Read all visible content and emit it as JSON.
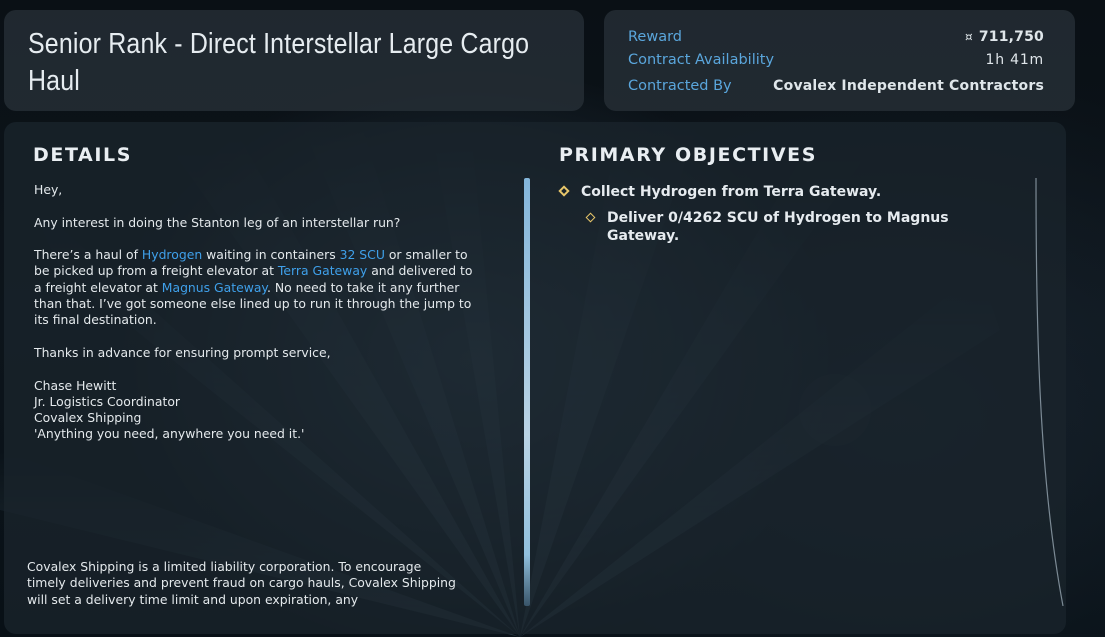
{
  "contract": {
    "title": "Senior Rank - Direct Interstellar Large Cargo Haul"
  },
  "info": {
    "reward_label": "Reward",
    "reward_currency_icon": "auec-currency-icon",
    "reward_value": "711,750",
    "availability_label": "Contract Availability",
    "availability_value": "1h 41m",
    "contracted_by_label": "Contracted By",
    "contracted_by_value": "Covalex Independent Contractors"
  },
  "details": {
    "heading": "DETAILS",
    "greeting": "Hey,",
    "question": "Any interest in doing the Stanton leg of an interstellar run?",
    "p3_a": "There’s a haul of ",
    "p3_commodity": "Hydrogen",
    "p3_b": " waiting in containers ",
    "p3_container": "32 SCU",
    "p3_c": " or smaller to be picked up from a freight elevator at ",
    "p3_pickup": "Terra Gateway",
    "p3_d": " and delivered to a freight elevator at ",
    "p3_dropoff": "Magnus Gateway",
    "p3_e": ". No need to take it any further than that. I’ve got someone else lined up to run it through the jump to its final destination.",
    "thanks": "Thanks in advance for ensuring prompt service,",
    "signature": {
      "name": "Chase Hewitt",
      "role": "Jr. Logistics Coordinator",
      "company": "Covalex Shipping",
      "motto": "'Anything you need, anywhere you need it.'"
    },
    "disclaimer": "Covalex Shipping is a limited liability corporation. To encourage timely deliveries and prevent fraud on cargo hauls, Covalex Shipping will set a delivery time limit and upon expiration, any"
  },
  "objectives": {
    "heading": "PRIMARY OBJECTIVES",
    "primary": "Collect Hydrogen from Terra Gateway.",
    "sub_line1": "Deliver 0/4262 SCU of Hydrogen to Magnus",
    "sub_line2": "Gateway."
  },
  "colors": {
    "accent_blue": "#3fa0ea",
    "label_blue": "#5aa6dc",
    "objective_gold": "#e7c66a"
  }
}
